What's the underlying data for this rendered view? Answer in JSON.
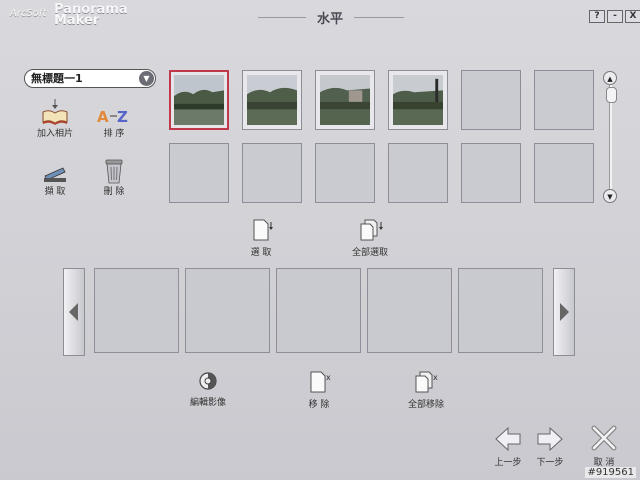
{
  "app": {
    "logo_small": "ArcSoft",
    "logo_big": "Panorama Maker",
    "title": "水平",
    "help_label": "?",
    "minimize_label": "-",
    "close_label": "X"
  },
  "project": {
    "selected": "無標題一1"
  },
  "tools": {
    "add_photos": "加入相片",
    "sort": "排 序",
    "capture": "擷 取",
    "delete": "刪 除"
  },
  "thumbnails": {
    "photos": [
      {
        "name": "photo-1",
        "selected": true
      },
      {
        "name": "photo-2",
        "selected": false
      },
      {
        "name": "photo-3",
        "selected": false
      },
      {
        "name": "photo-4",
        "selected": false
      }
    ],
    "empty_slots": 8
  },
  "actions": {
    "select": "選 取",
    "select_all": "全部選取",
    "edit_image": "編輯影像",
    "remove": "移 除",
    "remove_all": "全部移除"
  },
  "strip": {
    "slots": 5
  },
  "nav": {
    "prev_step": "上一步",
    "next_step": "下一步",
    "cancel": "取 消"
  },
  "watermark": "#919561",
  "colors": {
    "selection_border": "#c0394a",
    "background": "#d2d2d7"
  }
}
